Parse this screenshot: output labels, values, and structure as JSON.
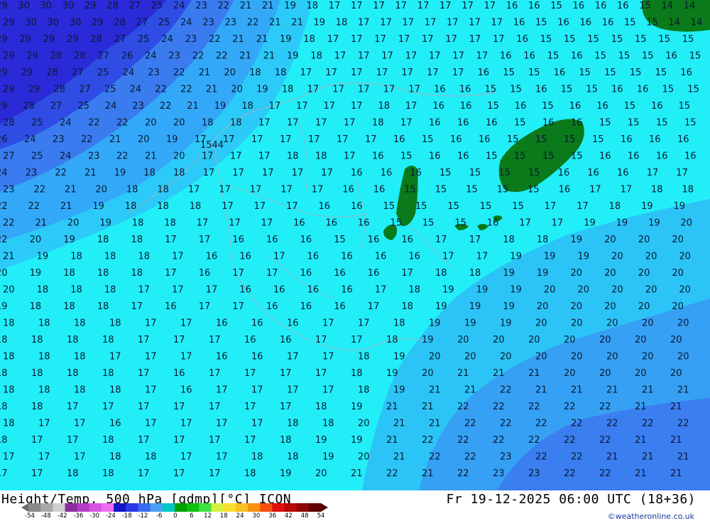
{
  "map": {
    "isolines": [
      {
        "row": 0,
        "values": [
          "29",
          "30",
          "30",
          "30",
          "29",
          "28",
          "27",
          "25",
          "24",
          "23",
          "22",
          "21",
          "21",
          "19",
          "18",
          "17",
          "17",
          "17",
          "17",
          "17",
          "17",
          "17",
          "17",
          "16",
          "16",
          "15",
          "16",
          "16",
          "16",
          "15",
          "14",
          "14"
        ]
      },
      {
        "row": 1,
        "values": [
          "29",
          "30",
          "30",
          "30",
          "29",
          "28",
          "27",
          "25",
          "24",
          "23",
          "23",
          "22",
          "21",
          "21",
          "19",
          "18",
          "17",
          "17",
          "17",
          "17",
          "17",
          "17",
          "17",
          "16",
          "15",
          "16",
          "16",
          "16",
          "15",
          "15",
          "14",
          "14"
        ]
      },
      {
        "row": 2,
        "values": [
          "29",
          "29",
          "29",
          "29",
          "28",
          "27",
          "25",
          "24",
          "23",
          "22",
          "21",
          "21",
          "19",
          "18",
          "17",
          "17",
          "17",
          "17",
          "17",
          "17",
          "17",
          "17",
          "16",
          "15",
          "15",
          "15",
          "15",
          "15",
          "15",
          "15"
        ]
      },
      {
        "row": 3,
        "values": [
          "29",
          "29",
          "28",
          "28",
          "27",
          "26",
          "24",
          "23",
          "22",
          "22",
          "21",
          "21",
          "19",
          "18",
          "17",
          "17",
          "17",
          "17",
          "17",
          "17",
          "17",
          "16",
          "16",
          "15",
          "16",
          "15",
          "15",
          "15",
          "16",
          "15"
        ]
      },
      {
        "row": 4,
        "values": [
          "29",
          "29",
          "28",
          "27",
          "25",
          "24",
          "23",
          "22",
          "21",
          "20",
          "18",
          "18",
          "17",
          "17",
          "17",
          "17",
          "17",
          "17",
          "17",
          "16",
          "15",
          "15",
          "16",
          "15",
          "15",
          "15",
          "15",
          "16"
        ]
      },
      {
        "row": 5,
        "values": [
          "29",
          "29",
          "28",
          "27",
          "25",
          "24",
          "22",
          "22",
          "21",
          "20",
          "19",
          "18",
          "17",
          "17",
          "17",
          "17",
          "17",
          "16",
          "16",
          "15",
          "15",
          "16",
          "15",
          "15",
          "16",
          "16",
          "15",
          "15"
        ]
      },
      {
        "row": 6,
        "values": [
          "29",
          "28",
          "27",
          "25",
          "24",
          "23",
          "22",
          "21",
          "19",
          "18",
          "17",
          "17",
          "17",
          "17",
          "18",
          "17",
          "16",
          "16",
          "15",
          "16",
          "15",
          "16",
          "16",
          "15",
          "16",
          "15"
        ]
      },
      {
        "row": 7,
        "values": [
          "28",
          "25",
          "24",
          "22",
          "22",
          "20",
          "20",
          "18",
          "18",
          "17",
          "17",
          "17",
          "17",
          "18",
          "17",
          "16",
          "16",
          "16",
          "15",
          "16",
          "16",
          "15",
          "15",
          "15",
          "15"
        ]
      },
      {
        "row": 8,
        "values": [
          "26",
          "24",
          "23",
          "22",
          "21",
          "20",
          "19",
          "17",
          "17",
          "17",
          "17",
          "17",
          "17",
          "17",
          "16",
          "15",
          "16",
          "16",
          "15",
          "15",
          "15",
          "15",
          "16",
          "16",
          "16"
        ]
      },
      {
        "row": 9,
        "values": [
          "27",
          "25",
          "24",
          "23",
          "22",
          "21",
          "20",
          "17",
          "17",
          "17",
          "18",
          "18",
          "17",
          "16",
          "15",
          "16",
          "16",
          "15",
          "15",
          "15",
          "15",
          "16",
          "16",
          "16",
          "16"
        ]
      },
      {
        "row": 10,
        "values": [
          "24",
          "23",
          "22",
          "21",
          "19",
          "18",
          "18",
          "17",
          "17",
          "17",
          "17",
          "17",
          "16",
          "16",
          "16",
          "15",
          "15",
          "15",
          "15",
          "16",
          "16",
          "16",
          "17",
          "17"
        ]
      },
      {
        "row": 11,
        "values": [
          "23",
          "22",
          "21",
          "20",
          "18",
          "18",
          "17",
          "17",
          "17",
          "17",
          "17",
          "16",
          "16",
          "15",
          "15",
          "15",
          "15",
          "15",
          "16",
          "17",
          "17",
          "18",
          "18"
        ]
      },
      {
        "row": 12,
        "values": [
          "22",
          "22",
          "21",
          "19",
          "18",
          "18",
          "18",
          "17",
          "17",
          "17",
          "16",
          "16",
          "15",
          "15",
          "15",
          "15",
          "15",
          "17",
          "17",
          "18",
          "19",
          "19"
        ]
      },
      {
        "row": 13,
        "values": [
          "22",
          "21",
          "20",
          "19",
          "18",
          "18",
          "17",
          "17",
          "17",
          "16",
          "16",
          "16",
          "15",
          "15",
          "15",
          "16",
          "17",
          "17",
          "19",
          "19",
          "19",
          "20"
        ]
      },
      {
        "row": 14,
        "values": [
          "22",
          "20",
          "19",
          "18",
          "18",
          "17",
          "17",
          "16",
          "16",
          "16",
          "15",
          "16",
          "16",
          "17",
          "17",
          "18",
          "18",
          "19",
          "20",
          "20",
          "20"
        ]
      },
      {
        "row": 15,
        "values": [
          "21",
          "19",
          "18",
          "18",
          "18",
          "17",
          "16",
          "16",
          "17",
          "16",
          "16",
          "16",
          "16",
          "17",
          "17",
          "19",
          "19",
          "19",
          "20",
          "20",
          "20"
        ]
      },
      {
        "row": 16,
        "values": [
          "20",
          "19",
          "18",
          "18",
          "18",
          "17",
          "16",
          "17",
          "17",
          "16",
          "16",
          "16",
          "17",
          "18",
          "18",
          "19",
          "19",
          "20",
          "20",
          "20",
          "20"
        ]
      },
      {
        "row": 17,
        "values": [
          "20",
          "18",
          "18",
          "18",
          "17",
          "17",
          "17",
          "16",
          "16",
          "16",
          "16",
          "17",
          "18",
          "19",
          "19",
          "19",
          "20",
          "20",
          "20",
          "20",
          "20"
        ]
      },
      {
        "row": 18,
        "values": [
          "19",
          "18",
          "18",
          "18",
          "17",
          "16",
          "17",
          "17",
          "16",
          "16",
          "16",
          "17",
          "18",
          "19",
          "19",
          "19",
          "20",
          "20",
          "20",
          "20",
          "20"
        ]
      },
      {
        "row": 19,
        "values": [
          "18",
          "18",
          "18",
          "18",
          "17",
          "17",
          "16",
          "16",
          "16",
          "17",
          "17",
          "18",
          "19",
          "19",
          "19",
          "20",
          "20",
          "20",
          "20",
          "20"
        ]
      },
      {
        "row": 20,
        "values": [
          "18",
          "18",
          "18",
          "18",
          "17",
          "17",
          "17",
          "16",
          "16",
          "17",
          "17",
          "18",
          "19",
          "20",
          "20",
          "20",
          "20",
          "20",
          "20",
          "20"
        ]
      },
      {
        "row": 21,
        "values": [
          "18",
          "18",
          "18",
          "17",
          "17",
          "17",
          "16",
          "16",
          "17",
          "17",
          "18",
          "19",
          "20",
          "20",
          "20",
          "20",
          "20",
          "20",
          "20",
          "20"
        ]
      },
      {
        "row": 22,
        "values": [
          "18",
          "18",
          "18",
          "18",
          "17",
          "16",
          "17",
          "17",
          "17",
          "17",
          "18",
          "19",
          "20",
          "21",
          "21",
          "21",
          "20",
          "20",
          "20",
          "20"
        ]
      },
      {
        "row": 23,
        "values": [
          "18",
          "18",
          "18",
          "18",
          "17",
          "16",
          "17",
          "17",
          "17",
          "17",
          "18",
          "19",
          "21",
          "21",
          "22",
          "21",
          "21",
          "21",
          "21",
          "21"
        ]
      },
      {
        "row": 24,
        "values": [
          "18",
          "18",
          "17",
          "17",
          "17",
          "17",
          "17",
          "17",
          "17",
          "18",
          "19",
          "21",
          "21",
          "22",
          "22",
          "22",
          "22",
          "22",
          "21",
          "21"
        ]
      },
      {
        "row": 25,
        "values": [
          "18",
          "17",
          "17",
          "16",
          "17",
          "17",
          "17",
          "17",
          "18",
          "18",
          "20",
          "21",
          "21",
          "22",
          "22",
          "22",
          "22",
          "22",
          "22",
          "22"
        ]
      },
      {
        "row": 26,
        "values": [
          "18",
          "17",
          "17",
          "18",
          "17",
          "17",
          "17",
          "17",
          "18",
          "19",
          "19",
          "21",
          "22",
          "22",
          "22",
          "22",
          "22",
          "22",
          "21",
          "21"
        ]
      },
      {
        "row": 27,
        "values": [
          "17",
          "17",
          "17",
          "18",
          "18",
          "17",
          "17",
          "18",
          "18",
          "19",
          "20",
          "21",
          "22",
          "22",
          "23",
          "22",
          "22",
          "21",
          "21",
          "21"
        ]
      },
      {
        "row": 28,
        "values": [
          "17",
          "17",
          "18",
          "18",
          "17",
          "17",
          "17",
          "18",
          "19",
          "20",
          "21",
          "22",
          "21",
          "22",
          "23",
          "23",
          "22",
          "22",
          "21",
          "21"
        ]
      }
    ],
    "city_label": "1544"
  },
  "footer": {
    "title_left": "Height/Temp. 500 hPa [gdmp][°C] ICON",
    "title_right": "Fr 19-12-2025 06:00 UTC (18+36)",
    "credit": "©weatheronline.co.uk",
    "scale_labels": [
      "-54",
      "-48",
      "-42",
      "-36",
      "-30",
      "-24",
      "-18",
      "-12",
      "-6",
      "0",
      "6",
      "12",
      "18",
      "24",
      "30",
      "36",
      "42",
      "48",
      "54"
    ],
    "scale_colors": [
      "#8a8a8a",
      "#a9a9a9",
      "#cfcfcf",
      "#8b2fa0",
      "#b43fc7",
      "#d653e0",
      "#f06cf0",
      "#1414c8",
      "#2a3ae8",
      "#3c6cf0",
      "#4aa0f5",
      "#00c8c8",
      "#00a000",
      "#10c010",
      "#40e040",
      "#d8f040",
      "#f8e030",
      "#f8c020",
      "#f89010",
      "#f85010",
      "#e01010",
      "#b80808",
      "#8c0404",
      "#600000"
    ]
  }
}
